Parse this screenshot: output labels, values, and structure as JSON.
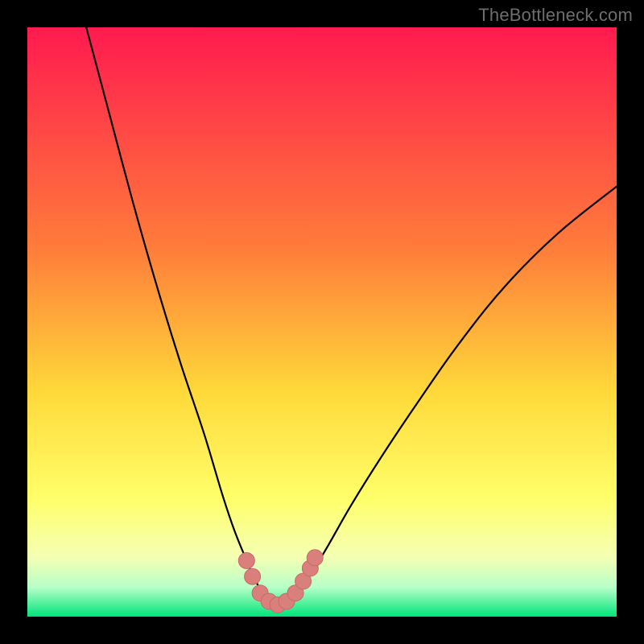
{
  "watermark": "TheBottleneck.com",
  "colors": {
    "frame": "#000000",
    "curve": "#000000",
    "marker_fill": "#d97f7c",
    "marker_stroke": "#c96a67",
    "grad_top": "#ff1a4f",
    "grad_mid1": "#ff7e3a",
    "grad_mid2": "#ffd93a",
    "grad_mid3": "#ffff6a",
    "grad_mid4": "#f4ffb4",
    "grad_mid5": "#b7ffc8",
    "grad_bottom": "#00e57a"
  },
  "chart_data": {
    "type": "line",
    "title": "",
    "xlabel": "",
    "ylabel": "",
    "xlim": [
      0,
      100
    ],
    "ylim": [
      0,
      100
    ],
    "grid": false,
    "series": [
      {
        "name": "bottleneck-curve",
        "x": [
          10,
          14,
          18,
          22,
          26,
          30,
          33,
          35,
          37,
          38.5,
          40,
          41.5,
          43,
          44.5,
          46,
          48,
          51,
          55,
          60,
          66,
          73,
          81,
          90,
          100
        ],
        "y": [
          100,
          85,
          70,
          56,
          43,
          31,
          21,
          15,
          10,
          6.5,
          4,
          2.5,
          2,
          2.5,
          4,
          7,
          12,
          19,
          27,
          36,
          46,
          56,
          65,
          73
        ]
      }
    ],
    "markers": {
      "name": "highlight-points",
      "x": [
        37.2,
        38.2,
        39.5,
        41.0,
        42.5,
        44.0,
        45.5,
        46.8,
        48.0,
        48.8
      ],
      "y": [
        9.5,
        6.8,
        4.0,
        2.6,
        2.0,
        2.6,
        4.0,
        6.0,
        8.2,
        10.0
      ]
    }
  }
}
